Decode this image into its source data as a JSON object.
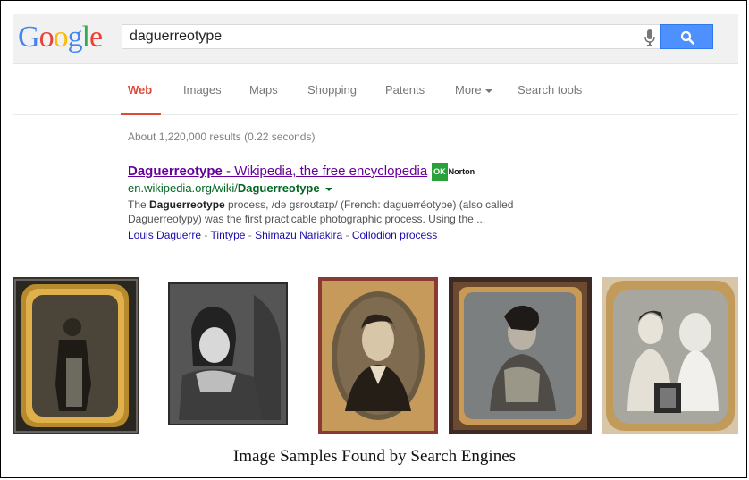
{
  "logo": {
    "text": "Google",
    "letters": [
      {
        "ch": "G",
        "color": "#4285f4"
      },
      {
        "ch": "o",
        "color": "#ea4335"
      },
      {
        "ch": "o",
        "color": "#fbbc05"
      },
      {
        "ch": "g",
        "color": "#4285f4"
      },
      {
        "ch": "l",
        "color": "#34a853"
      },
      {
        "ch": "e",
        "color": "#ea4335"
      }
    ]
  },
  "search": {
    "query": "daguerreotype",
    "mic_icon": "microphone-icon",
    "button_icon": "magnifier-icon",
    "button_color": "#4d90fe"
  },
  "tabs": [
    {
      "label": "Web",
      "active": true
    },
    {
      "label": "Images"
    },
    {
      "label": "Maps"
    },
    {
      "label": "Shopping"
    },
    {
      "label": "Patents"
    },
    {
      "label": "More"
    },
    {
      "label": "Search tools"
    }
  ],
  "stats": "About 1,220,000 results (0.22 seconds)",
  "result": {
    "title_bold": "Daguerreotype",
    "title_rest": " - Wikipedia, the free encyclopedia",
    "badge_ok": "OK",
    "badge_name": "Norton",
    "url_prefix": "en.wikipedia.org/wiki/",
    "url_bold": "Daguerreotype",
    "snippet_1a": "The ",
    "snippet_1b": "Daguerreotype",
    "snippet_1c": " process, /də ɡɛroʊtaɪp/ (French: daguerréotype) (also called",
    "snippet_2": "Daguerreotypy) was the first practicable photographic process. Using the ...",
    "links": [
      "Louis Daguerre",
      "Tintype",
      "Shimazu Nariakira",
      "Collodion process"
    ],
    "colors": {
      "title": "#660099",
      "url": "#006621",
      "link": "#1a0dab"
    }
  },
  "images": [
    {
      "name": "daguerreotype-standing-man"
    },
    {
      "name": "daguerreotype-child"
    },
    {
      "name": "daguerreotype-poe-portrait"
    },
    {
      "name": "daguerreotype-woman-profile"
    },
    {
      "name": "daguerreotype-two-girls"
    }
  ],
  "caption": "Image Samples Found by Search Engines"
}
